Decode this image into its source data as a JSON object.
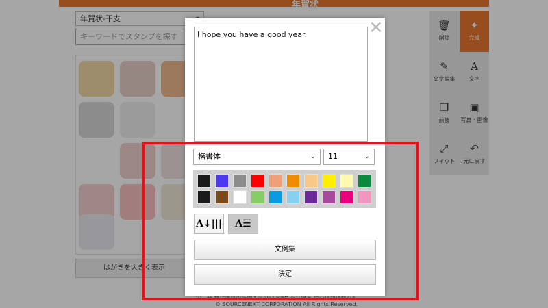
{
  "app": {
    "brand": "年賀状",
    "category_select": "年賀状-干支",
    "stamp_search_placeholder": "キーワードでスタンプを探す",
    "show_postcard_label": "はがきを大きく表示",
    "tools": [
      {
        "label": "削除",
        "icon": "trash-icon"
      },
      {
        "label": "完成",
        "icon": "sparkle-icon"
      },
      {
        "label": "文字編集",
        "icon": "pencil-icon"
      },
      {
        "label": "文字",
        "icon": "letter-a-icon"
      },
      {
        "label": "前後",
        "icon": "layers-icon"
      },
      {
        "label": "写真・画像",
        "icon": "image-icon"
      },
      {
        "label": "フィット",
        "icon": "fit-icon"
      },
      {
        "label": "元に戻す",
        "icon": "undo-icon"
      }
    ],
    "footer_links": "ホーム  著作権表示に関する規約  Q&A  会社概要  個人情報保護方針",
    "copyright": "© SOURCENEXT CORPORATION All Rights Reserved."
  },
  "dialog": {
    "text_value": "I hope you have a good year.",
    "font_select": "楷書体",
    "size_select": "11",
    "close_icon": "✕",
    "vertical_label": "A↓|||",
    "horizontal_label": "A",
    "samples_button": "文例集",
    "decide_button": "決定"
  },
  "palette": {
    "row1": [
      "#1a1a1a",
      "#4b3af0",
      "#8c8c8c",
      "#ff0000",
      "#f0a078",
      "#f08c00",
      "#f8c888",
      "#ffee00",
      "#fff8b0",
      "#0a8a3c"
    ],
    "row2": [
      "#1a1a1a",
      "#7a4a1a",
      "#ffffff",
      "#88cc66",
      "#0a9be0",
      "#88d0f0",
      "#6a2a98",
      "#a84a9c",
      "#e8007c",
      "#f096c0"
    ]
  },
  "colors": {
    "accent": "#e8772e",
    "highlight": "#e8111a"
  }
}
